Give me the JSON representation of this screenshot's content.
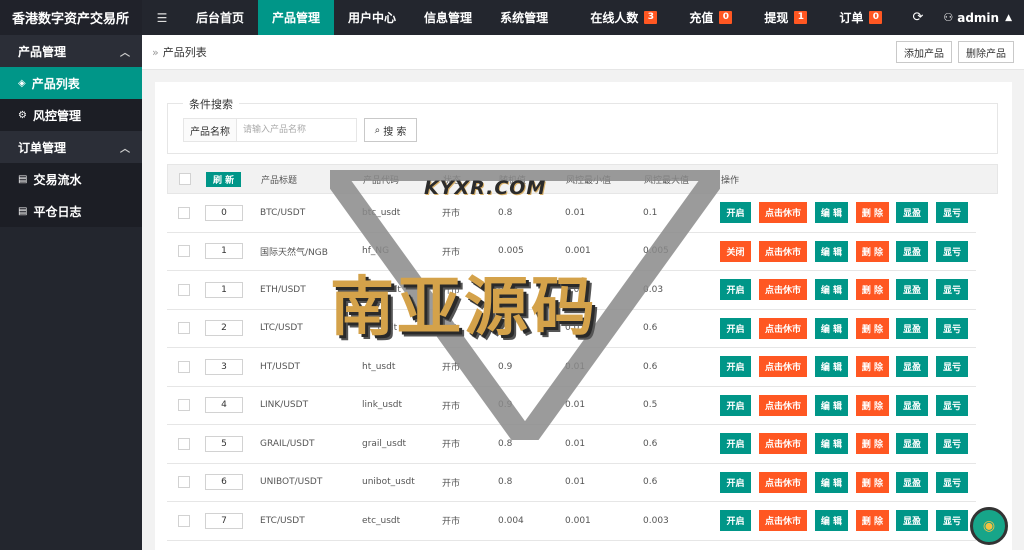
{
  "header": {
    "brand": "香港数字资产交易所",
    "menu_icon": "menu-icon",
    "nav": [
      "后台首页",
      "产品管理",
      "用户中心",
      "信息管理",
      "系统管理"
    ],
    "right": {
      "online": {
        "label": "在线人数",
        "count": "3"
      },
      "deposit": {
        "label": "充值",
        "count": "0"
      },
      "withdraw": {
        "label": "提现",
        "count": "1"
      },
      "orders": {
        "label": "订单",
        "count": "0"
      },
      "user": "admin"
    }
  },
  "sidebar": {
    "group1": "产品管理",
    "item_list": "产品列表",
    "item_risk": "风控管理",
    "group2": "订单管理",
    "item_flow": "交易流水",
    "item_close": "平仓日志"
  },
  "breadcrumb": {
    "current": "产品列表",
    "add_btn": "添加产品",
    "delete_btn": "删除产品"
  },
  "search": {
    "legend": "条件搜索",
    "label": "产品名称",
    "placeholder": "请输入产品名称",
    "button": "搜 索"
  },
  "table": {
    "refresh": "刷 新",
    "headers": {
      "title": "产品标题",
      "code": "产品代码",
      "status": "状态",
      "random": "随机值",
      "risk_min": "风控最小值",
      "risk_max": "风控最大值",
      "ops": "操作"
    },
    "rows": [
      {
        "sort": "0",
        "title": "BTC/USDT",
        "code": "btc_usdt",
        "status": "开市",
        "random": "0.8",
        "min": "0.01",
        "max": "0.1",
        "toggle": "开启",
        "toggle_color": "teal"
      },
      {
        "sort": "1",
        "title": "国际天然气/NGB",
        "code": "hf_NG",
        "status": "开市",
        "random": "0.005",
        "min": "0.001",
        "max": "0.005",
        "toggle": "关闭",
        "toggle_color": "orange"
      },
      {
        "sort": "1",
        "title": "ETH/USDT",
        "code": "eth_usdt",
        "status": "开市",
        "random": "0.05",
        "min": "0.01",
        "max": "0.03",
        "toggle": "开启",
        "toggle_color": "teal"
      },
      {
        "sort": "2",
        "title": "LTC/USDT",
        "code": "ltc_usdt",
        "status": "开市",
        "random": "0.8",
        "min": "0.01",
        "max": "0.6",
        "toggle": "开启",
        "toggle_color": "teal"
      },
      {
        "sort": "3",
        "title": "HT/USDT",
        "code": "ht_usdt",
        "status": "开市",
        "random": "0.9",
        "min": "0.01",
        "max": "0.6",
        "toggle": "开启",
        "toggle_color": "teal"
      },
      {
        "sort": "4",
        "title": "LINK/USDT",
        "code": "link_usdt",
        "status": "开市",
        "random": "0.9",
        "min": "0.01",
        "max": "0.5",
        "toggle": "开启",
        "toggle_color": "teal"
      },
      {
        "sort": "5",
        "title": "GRAIL/USDT",
        "code": "grail_usdt",
        "status": "开市",
        "random": "0.8",
        "min": "0.01",
        "max": "0.6",
        "toggle": "开启",
        "toggle_color": "teal"
      },
      {
        "sort": "6",
        "title": "UNIBOT/USDT",
        "code": "unibot_usdt",
        "status": "开市",
        "random": "0.8",
        "min": "0.01",
        "max": "0.6",
        "toggle": "开启",
        "toggle_color": "teal"
      },
      {
        "sort": "7",
        "title": "ETC/USDT",
        "code": "etc_usdt",
        "status": "开市",
        "random": "0.004",
        "min": "0.001",
        "max": "0.003",
        "toggle": "开启",
        "toggle_color": "teal"
      }
    ],
    "actions": {
      "suspend": "点击休市",
      "edit": "编 辑",
      "delete": "删 除",
      "win": "显盈",
      "lose": "显亏"
    }
  },
  "watermark": {
    "site": "KYXR.COM",
    "title": "南亚源码"
  },
  "colors": {
    "teal": "#009688",
    "orange": "#ff5722",
    "dark": "#23262e"
  }
}
